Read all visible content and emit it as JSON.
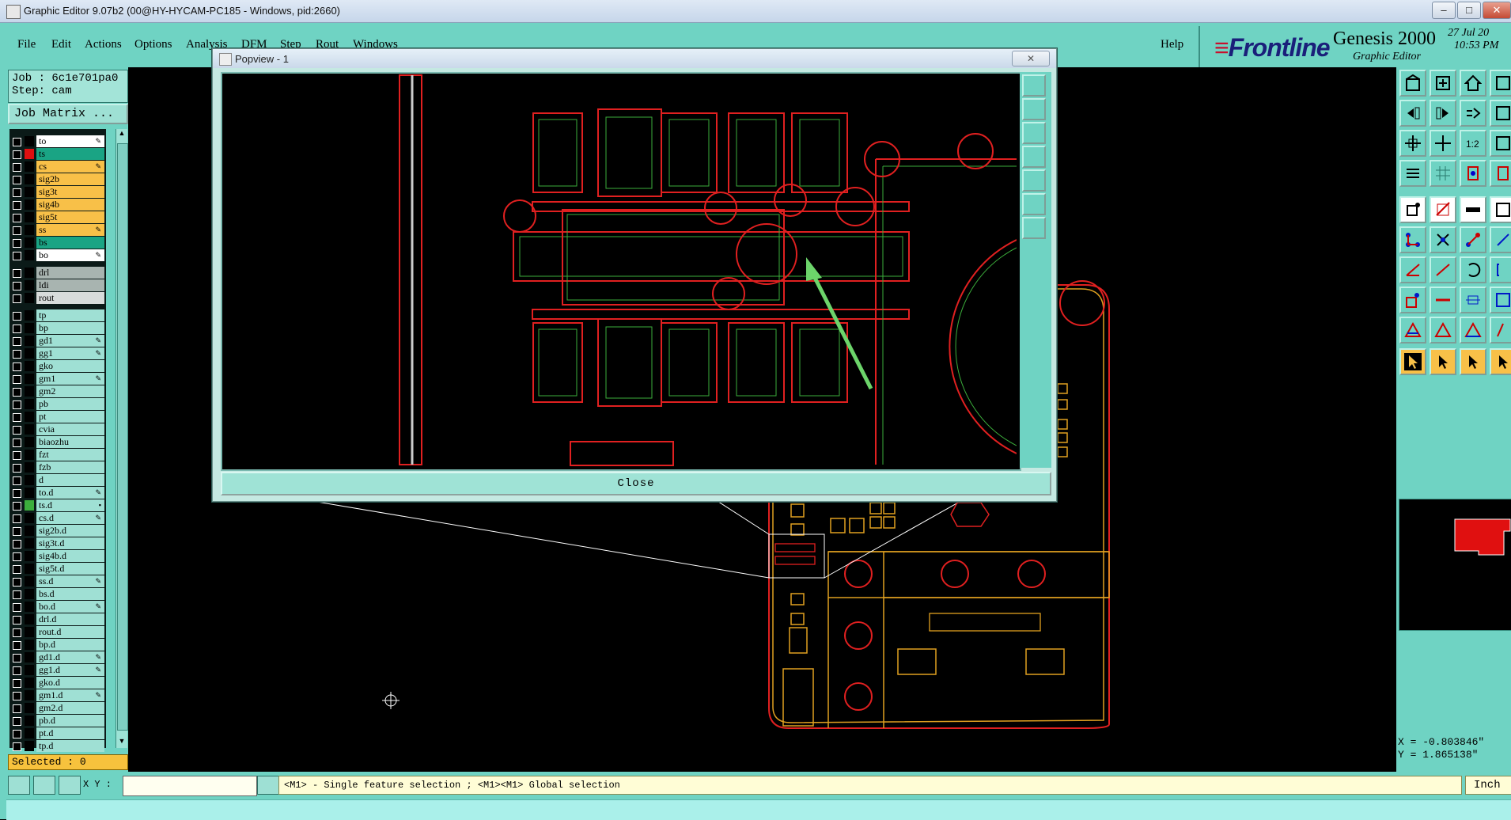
{
  "window": {
    "title": "Graphic Editor 9.07b2 (00@HY-HYCAM-PC185 - Windows, pid:2660)",
    "minimize": "–",
    "maximize": "□",
    "close": "✕"
  },
  "menu": {
    "items": [
      "File",
      "Edit",
      "Actions",
      "Options",
      "Analysis",
      "DFM",
      "Step",
      "Rout",
      "Windows"
    ],
    "help": "Help"
  },
  "brand": {
    "logo": "Frontline",
    "product": "Genesis 2000",
    "subtitle": "Graphic Editor",
    "date": "27 Jul 20",
    "time": "10:53 PM"
  },
  "job": {
    "job_line": "Job : 6c1e701pa0",
    "step_line": "Step: cam",
    "matrix_button": "Job Matrix ..."
  },
  "layers": [
    {
      "name": "to",
      "color": "#000000",
      "bg": "#ffffff",
      "mark": "✎"
    },
    {
      "name": "ts",
      "color": "#e01010",
      "bg": "#1aa484",
      "mark": ""
    },
    {
      "name": "cs",
      "color": "#000000",
      "bg": "#f8c048",
      "mark": "✎"
    },
    {
      "name": "sig2b",
      "color": "#000000",
      "bg": "#f8c048",
      "mark": ""
    },
    {
      "name": "sig3t",
      "color": "#000000",
      "bg": "#f8c048",
      "mark": ""
    },
    {
      "name": "sig4b",
      "color": "#000000",
      "bg": "#f8c048",
      "mark": ""
    },
    {
      "name": "sig5t",
      "color": "#000000",
      "bg": "#f8c048",
      "mark": ""
    },
    {
      "name": "ss",
      "color": "#000000",
      "bg": "#f8c048",
      "mark": "✎"
    },
    {
      "name": "bs",
      "color": "#000000",
      "bg": "#1aa484",
      "mark": ""
    },
    {
      "name": "bo",
      "color": "#000000",
      "bg": "#ffffff",
      "mark": "✎"
    },
    {
      "gap": true
    },
    {
      "name": "drl",
      "color": "#000000",
      "bg": "#a8b4b0",
      "mark": ""
    },
    {
      "name": "ldi",
      "color": "#000000",
      "bg": "#a8b4b0",
      "mark": ""
    },
    {
      "name": "rout",
      "color": "#000000",
      "bg": "#d8dcdb",
      "mark": ""
    },
    {
      "gap": true
    },
    {
      "name": "tp",
      "color": "#000000",
      "bg": "#9fe0d4",
      "mark": ""
    },
    {
      "name": "bp",
      "color": "#000000",
      "bg": "#9fe0d4",
      "mark": ""
    },
    {
      "name": "gd1",
      "color": "#000000",
      "bg": "#9fe0d4",
      "mark": "✎"
    },
    {
      "name": "gg1",
      "color": "#000000",
      "bg": "#9fe0d4",
      "mark": "✎"
    },
    {
      "name": "gko",
      "color": "#000000",
      "bg": "#9fe0d4",
      "mark": ""
    },
    {
      "name": "gm1",
      "color": "#000000",
      "bg": "#9fe0d4",
      "mark": "✎"
    },
    {
      "name": "gm2",
      "color": "#000000",
      "bg": "#9fe0d4",
      "mark": ""
    },
    {
      "name": "pb",
      "color": "#000000",
      "bg": "#9fe0d4",
      "mark": ""
    },
    {
      "name": "pt",
      "color": "#000000",
      "bg": "#9fe0d4",
      "mark": ""
    },
    {
      "name": "cvia",
      "color": "#000000",
      "bg": "#9fe0d4",
      "mark": ""
    },
    {
      "name": "biaozhu",
      "color": "#000000",
      "bg": "#9fe0d4",
      "mark": ""
    },
    {
      "name": "fzt",
      "color": "#000000",
      "bg": "#9fe0d4",
      "mark": ""
    },
    {
      "name": "fzb",
      "color": "#000000",
      "bg": "#9fe0d4",
      "mark": ""
    },
    {
      "name": "d",
      "color": "#000000",
      "bg": "#9fe0d4",
      "mark": ""
    },
    {
      "name": "to.d",
      "color": "#000000",
      "bg": "#9fe0d4",
      "mark": "✎"
    },
    {
      "name": "ts.d",
      "color": "#1018c8",
      "bg": "#9fe0d4",
      "mark": "▪",
      "swatch2": "#3cae3c"
    },
    {
      "name": "cs.d",
      "color": "#000000",
      "bg": "#9fe0d4",
      "mark": "✎"
    },
    {
      "name": "sig2b.d",
      "color": "#000000",
      "bg": "#9fe0d4",
      "mark": ""
    },
    {
      "name": "sig3t.d",
      "color": "#000000",
      "bg": "#9fe0d4",
      "mark": ""
    },
    {
      "name": "sig4b.d",
      "color": "#000000",
      "bg": "#9fe0d4",
      "mark": ""
    },
    {
      "name": "sig5t.d",
      "color": "#000000",
      "bg": "#9fe0d4",
      "mark": ""
    },
    {
      "name": "ss.d",
      "color": "#000000",
      "bg": "#9fe0d4",
      "mark": "✎"
    },
    {
      "name": "bs.d",
      "color": "#000000",
      "bg": "#9fe0d4",
      "mark": ""
    },
    {
      "name": "bo.d",
      "color": "#000000",
      "bg": "#9fe0d4",
      "mark": "✎"
    },
    {
      "name": "drl.d",
      "color": "#000000",
      "bg": "#9fe0d4",
      "mark": ""
    },
    {
      "name": "rout.d",
      "color": "#000000",
      "bg": "#9fe0d4",
      "mark": ""
    },
    {
      "name": "bp.d",
      "color": "#000000",
      "bg": "#9fe0d4",
      "mark": ""
    },
    {
      "name": "gd1.d",
      "color": "#000000",
      "bg": "#9fe0d4",
      "mark": "✎"
    },
    {
      "name": "gg1.d",
      "color": "#000000",
      "bg": "#9fe0d4",
      "mark": "✎"
    },
    {
      "name": "gko.d",
      "color": "#000000",
      "bg": "#9fe0d4",
      "mark": ""
    },
    {
      "name": "gm1.d",
      "color": "#000000",
      "bg": "#9fe0d4",
      "mark": "✎"
    },
    {
      "name": "gm2.d",
      "color": "#000000",
      "bg": "#9fe0d4",
      "mark": ""
    },
    {
      "name": "pb.d",
      "color": "#000000",
      "bg": "#9fe0d4",
      "mark": ""
    },
    {
      "name": "pt.d",
      "color": "#000000",
      "bg": "#9fe0d4",
      "mark": ""
    },
    {
      "name": "tp.d",
      "color": "#000000",
      "bg": "#9fe0d4",
      "mark": ""
    }
  ],
  "selected": "Selected : 0",
  "popview": {
    "title": "Popview - 1",
    "close_x": "✕",
    "close_button": "Close"
  },
  "coords": {
    "x": "X = -0.803846\"",
    "y": "Y =  1.865138\""
  },
  "bottom": {
    "xy_label": "X Y :",
    "xy_value": "",
    "status": "<M1> - Single feature selection ; <M1><M1> Global selection",
    "unit": "Inch"
  },
  "colors": {
    "panel": "#6fd3c3",
    "pcb_red": "#e02020",
    "pcb_orange": "#e0a020",
    "arrow_green": "#6cd46a"
  }
}
